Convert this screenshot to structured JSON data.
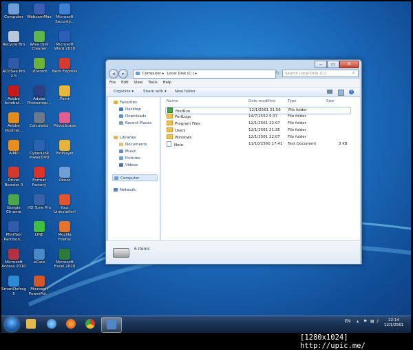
{
  "desktop_icons": [
    {
      "label": "Computer",
      "color": "#6d9fd4"
    },
    {
      "label": "WebcamMax",
      "color": "#3b5fb0"
    },
    {
      "label": "Microsoft\nSecurity...",
      "color": "#3e7fd0"
    },
    {
      "label": "Recycle Bin",
      "color": "#b8c8d8"
    },
    {
      "label": "Wise Disk\nCleaner",
      "color": "#5fb64c"
    },
    {
      "label": "Microsoft\nWord 2010",
      "color": "#2b5fb7"
    },
    {
      "label": "ACDSee Pro\n2.5",
      "color": "#2f5aa8"
    },
    {
      "label": "uTorrent",
      "color": "#6cb23b"
    },
    {
      "label": "Nero Express",
      "color": "#d33b2e"
    },
    {
      "label": "Adobe\nAcrobat...",
      "color": "#c41a1a"
    },
    {
      "label": "Adobe\nPhotoshop...",
      "color": "#2a3f86"
    },
    {
      "label": "Paint",
      "color": "#e8b63a"
    },
    {
      "label": "Adobe\nIllustrat...",
      "color": "#e48b1c"
    },
    {
      "label": "Calculator",
      "color": "#6a7a8a"
    },
    {
      "label": "PhotoScape",
      "color": "#e05f8f"
    },
    {
      "label": "AIMP",
      "color": "#e98d1c"
    },
    {
      "label": "CyberLink\nPowerDVD",
      "color": "#2a62b3"
    },
    {
      "label": "PotPlayer",
      "color": "#e7b23a"
    },
    {
      "label": "Driver\nBooster 3",
      "color": "#d33a2c"
    },
    {
      "label": "Format\nFactory",
      "color": "#d9332a"
    },
    {
      "label": "Okozo",
      "color": "#6f9fd6"
    },
    {
      "label": "Google\nChrome",
      "color": "#4aa84a"
    },
    {
      "label": "HD Tune Pro",
      "color": "#3a62a8"
    },
    {
      "label": "Your\nUninstaller!",
      "color": "#e2542f"
    },
    {
      "label": "MiniTool\nPartition...",
      "color": "#2e5caa"
    },
    {
      "label": "LINE",
      "color": "#3fbf3f"
    },
    {
      "label": "Mozilla\nFirefox",
      "color": "#e3742a"
    },
    {
      "label": "Microsoft\nAccess 2010",
      "color": "#b2323f"
    },
    {
      "label": "eCare",
      "color": "#4b88c8"
    },
    {
      "label": "Microsoft\nExcel 2010",
      "color": "#2d7b3c"
    },
    {
      "label": "SmartDefrag\n5",
      "color": "#2e8ad1"
    },
    {
      "label": "Microsoft\nPowerPoi...",
      "color": "#d2562a"
    }
  ],
  "window": {
    "address_parts": [
      "Computer",
      "Local Disk (C:)"
    ],
    "search_placeholder": "Search Local Disk (C:)",
    "controls": {
      "minimize": "–",
      "maximize": "▭",
      "close": "✕"
    },
    "menu": [
      "File",
      "Edit",
      "View",
      "Tools",
      "Help"
    ],
    "commands": {
      "organize": "Organize ▾",
      "share": "Share with ▾",
      "new_folder": "New folder"
    },
    "nav": {
      "favorites": "Favorites",
      "desktop": "Desktop",
      "downloads": "Downloads",
      "recent": "Recent Places",
      "libraries": "Libraries",
      "documents": "Documents",
      "music": "Music",
      "pictures": "Pictures",
      "videos": "Videos",
      "computer": "Computer",
      "network": "Network"
    },
    "columns": {
      "name": "Name",
      "date": "Date modified",
      "type": "Type",
      "size": "Size"
    },
    "files": [
      {
        "name": "firstRun",
        "date": "12/1/2561 21:59",
        "type": "File folder",
        "size": ""
      },
      {
        "name": "PerfLogs",
        "date": "14/7/2552 9:37",
        "type": "File folder",
        "size": ""
      },
      {
        "name": "Program Files",
        "date": "12/1/2561 22:07",
        "type": "File folder",
        "size": ""
      },
      {
        "name": "Users",
        "date": "12/1/2561 21:35",
        "type": "File folder",
        "size": ""
      },
      {
        "name": "Windows",
        "date": "12/1/2561 22:07",
        "type": "File folder",
        "size": ""
      },
      {
        "name": "Note",
        "date": "11/10/2560 17:41",
        "type": "Text Document",
        "size": "3 KB"
      }
    ],
    "item_count": "6 items"
  },
  "taskbar": {
    "lang": "EN",
    "time": "22:14",
    "date": "12/1/2561"
  },
  "watermark": "[1280x1024] http://upic.me/"
}
